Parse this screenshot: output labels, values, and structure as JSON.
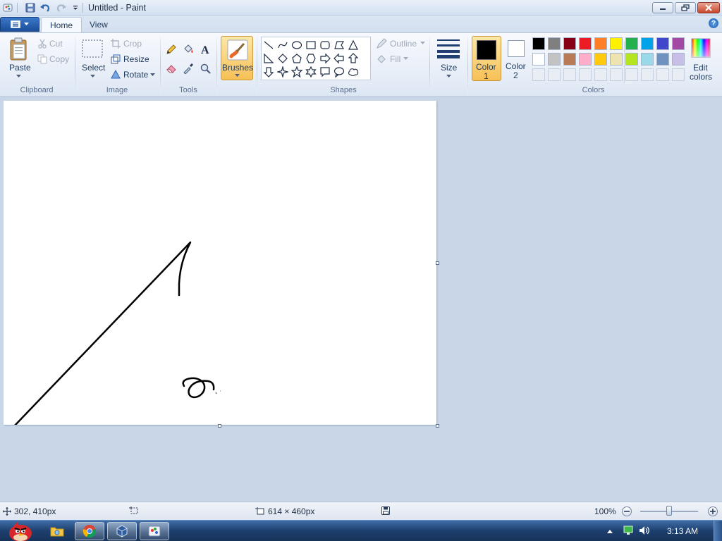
{
  "window": {
    "title": "Untitled - Paint"
  },
  "tabs": {
    "home": "Home",
    "view": "View"
  },
  "help": "?",
  "clipboard": {
    "paste": "Paste",
    "cut": "Cut",
    "copy": "Copy",
    "group": "Clipboard"
  },
  "image": {
    "select": "Select",
    "crop": "Crop",
    "resize": "Resize",
    "rotate": "Rotate",
    "group": "Image"
  },
  "tools": {
    "group": "Tools"
  },
  "brushes": {
    "label": "Brushes"
  },
  "shapes": {
    "outline": "Outline",
    "fill": "Fill",
    "group": "Shapes"
  },
  "size": {
    "label": "Size"
  },
  "colors": {
    "color1_line1": "Color",
    "color1_line2": "1",
    "color2_line1": "Color",
    "color2_line2": "2",
    "edit_line1": "Edit",
    "edit_line2": "colors",
    "group": "Colors",
    "row1": [
      "#000000",
      "#7f7f7f",
      "#880015",
      "#ed1c24",
      "#ff7f27",
      "#fff200",
      "#22b14c",
      "#00a2e8",
      "#3f48cc",
      "#a349a4"
    ],
    "row2": [
      "#ffffff",
      "#c3c3c3",
      "#b97a57",
      "#ffaec9",
      "#ffc90e",
      "#efe4b0",
      "#b5e61d",
      "#99d9ea",
      "#7092be",
      "#c8bfe7"
    ]
  },
  "status": {
    "cursor": "302, 410px",
    "size": "614 × 460px",
    "zoom": "100%"
  },
  "taskbar": {
    "clock": "3:13 AM"
  }
}
